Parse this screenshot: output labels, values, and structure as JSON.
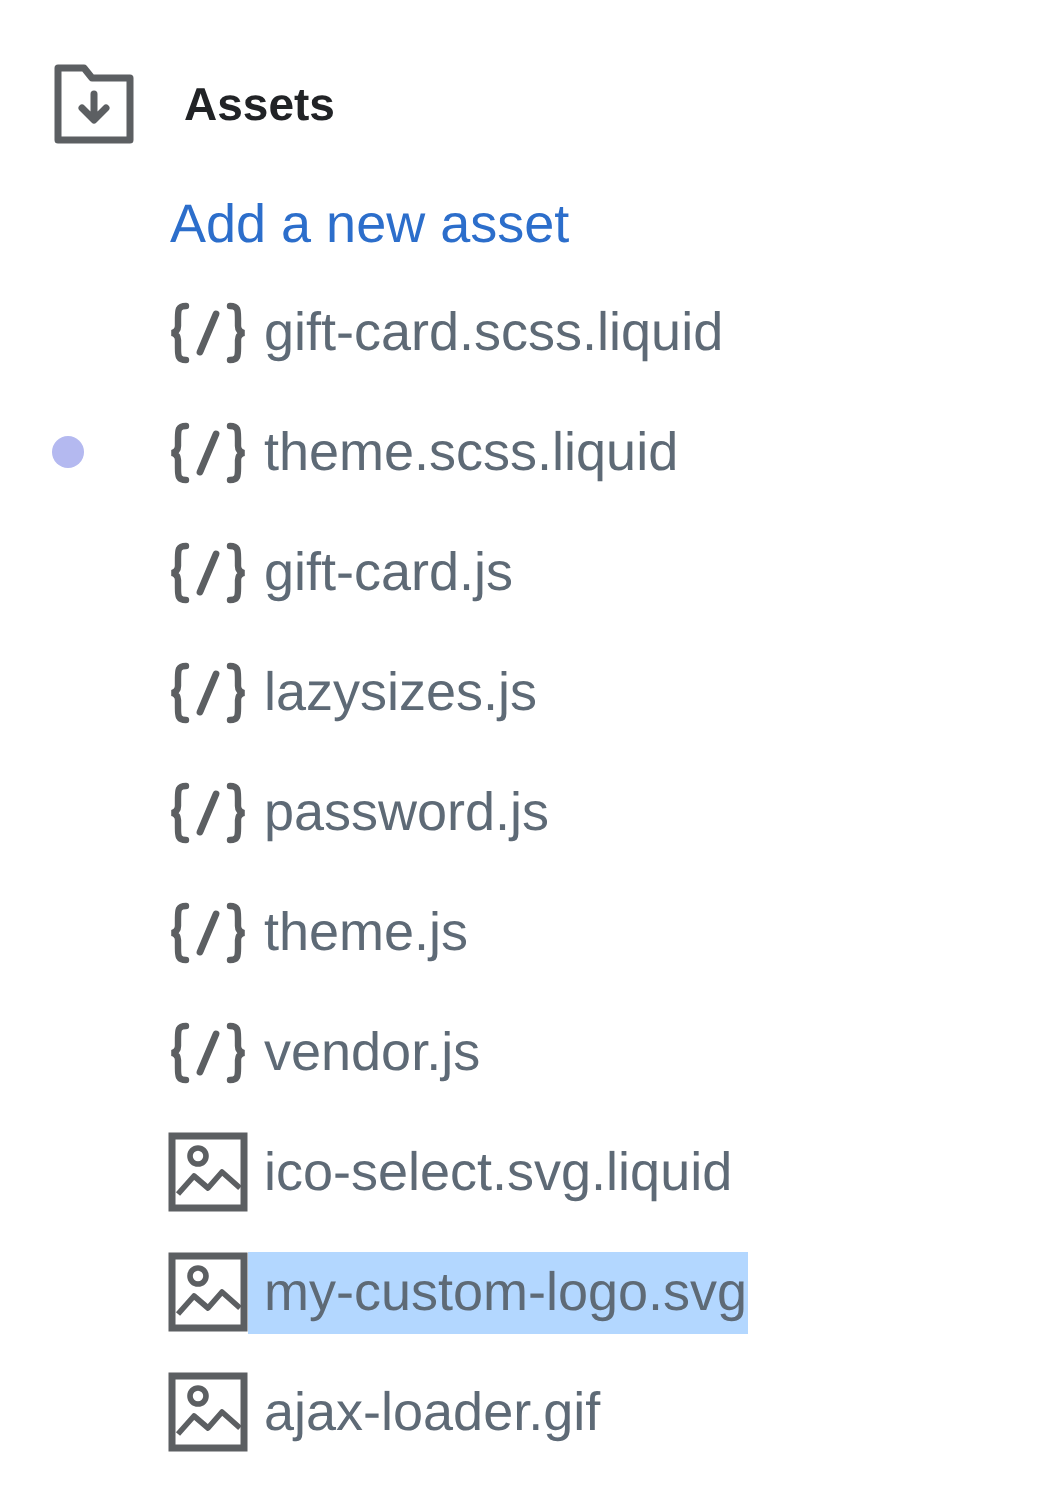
{
  "section": {
    "title": "Assets",
    "add_link": "Add a new asset"
  },
  "files": [
    {
      "name": "gift-card.scss.liquid",
      "kind": "code",
      "modified": false,
      "selected": false
    },
    {
      "name": "theme.scss.liquid",
      "kind": "code",
      "modified": true,
      "selected": false
    },
    {
      "name": "gift-card.js",
      "kind": "code",
      "modified": false,
      "selected": false
    },
    {
      "name": "lazysizes.js",
      "kind": "code",
      "modified": false,
      "selected": false
    },
    {
      "name": "password.js",
      "kind": "code",
      "modified": false,
      "selected": false
    },
    {
      "name": "theme.js",
      "kind": "code",
      "modified": false,
      "selected": false
    },
    {
      "name": "vendor.js",
      "kind": "code",
      "modified": false,
      "selected": false
    },
    {
      "name": "ico-select.svg.liquid",
      "kind": "image",
      "modified": false,
      "selected": false
    },
    {
      "name": "my-custom-logo.svg",
      "kind": "image",
      "modified": false,
      "selected": true
    },
    {
      "name": "ajax-loader.gif",
      "kind": "image",
      "modified": false,
      "selected": false
    }
  ]
}
